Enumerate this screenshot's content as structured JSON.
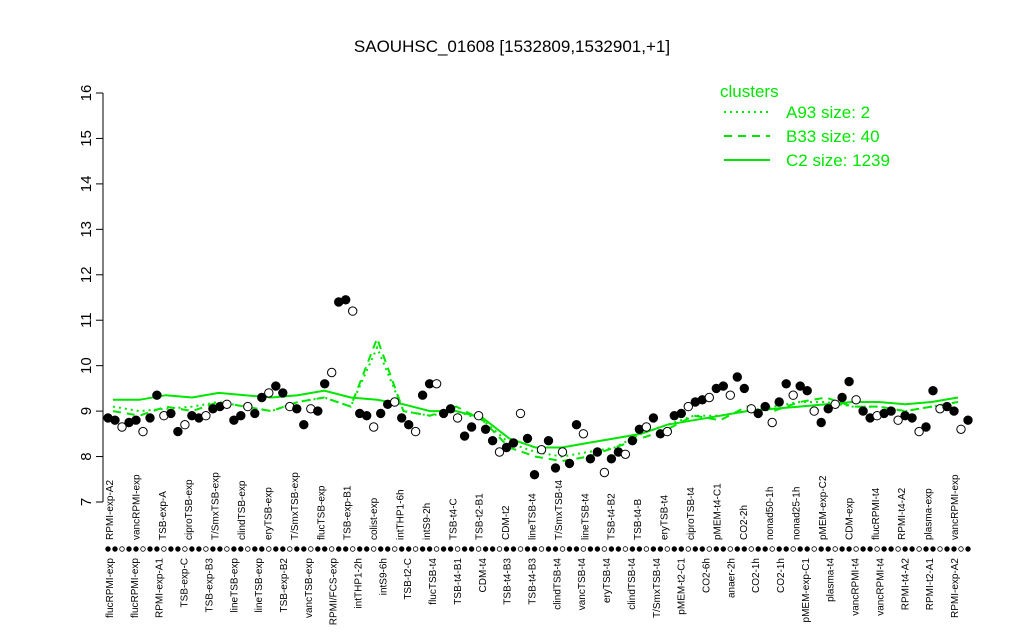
{
  "chart_data": {
    "type": "line",
    "title": "SAOUHSC_01608 [1532809,1532901,+1]",
    "xlabel": "",
    "ylabel": "",
    "ylim": [
      7,
      16
    ],
    "yticks": [
      7,
      8,
      9,
      10,
      11,
      12,
      13,
      14,
      15,
      16
    ],
    "x_labels_top": [
      "RPMI-exp-A2",
      "vancRPMI-exp",
      "TSB-exp-A",
      "ciproTSB-exp",
      "T/SmxTSB-exp",
      "clindTSB-exp",
      "eryTSB-exp",
      "T/SmxTSB-exp",
      "flucTSB-exp",
      "TSB-exp-B1",
      "colist-exp",
      "intTHP1-6h",
      "intS9-2h",
      "TSB-t4-C",
      "TSB-t2-B1",
      "CDM-t2",
      "lineTSB-t4",
      "T/SmxTSB-t4",
      "lineTSB-t4",
      "TSB-t4-B2",
      "TSB-t4-B",
      "eryTSB-t4",
      "ciproTSB-t4",
      "pMEM-t4-C1",
      "CO2-2h",
      "nonad50-1h",
      "nonad25-1h",
      "pMEM-exp-C2",
      "CDM-exp",
      "flucRPMI-t4",
      "RPMI-t4-A2",
      "plasma-exp",
      "vancRPMI-exp"
    ],
    "x_labels_bottom": [
      "flucRPMI-exp",
      "flucRPMI-exp",
      "RPMI-exp-A1",
      "TSB-exp-C",
      "TSB-exp-B3",
      "lineTSB-exp",
      "lineTSB-exp",
      "TSB-exp-B2",
      "vancTSB-exp",
      "RPMI/FCS-exp",
      "intTHP1-2h",
      "intS9-6h",
      "TSB-t2-C",
      "flucTSB-t4",
      "TSB-t4-B1",
      "CDM-t4",
      "TSB-t4-B3",
      "TSB-t4-B3",
      "clindTSB-t4",
      "vancTSB-t4",
      "eryTSB-t4",
      "clindTSB-t4",
      "T/SmxTSB-t4",
      "pMEM-t2-C1",
      "CO2-6h",
      "anaer-2h",
      "CO2-1h",
      "CO2-1h",
      "pMEM-exp-C1",
      "plasma-t4",
      "vancRPMI-t4",
      "vancRPMI-t4",
      "RPMI-t4-A2",
      "RPMI-t2-A1",
      "RPMI-exp-A2"
    ],
    "legend": {
      "title": "clusters",
      "position": "top-right",
      "entries": [
        {
          "label": "A93 size: 2",
          "style": "dotted"
        },
        {
          "label": "B33 size: 40",
          "style": "dashed"
        },
        {
          "label": "C2 size: 1239",
          "style": "solid"
        }
      ]
    },
    "colors": {
      "cluster": "#00e600",
      "points": "#000000"
    },
    "points": [
      [
        1,
        8.85
      ],
      [
        2,
        8.8
      ],
      [
        3,
        8.65
      ],
      [
        4,
        8.75
      ],
      [
        5,
        8.8
      ],
      [
        6,
        8.55
      ],
      [
        7,
        8.85
      ],
      [
        8,
        9.35
      ],
      [
        9,
        8.9
      ],
      [
        10,
        8.95
      ],
      [
        11,
        8.55
      ],
      [
        12,
        8.7
      ],
      [
        13,
        8.9
      ],
      [
        14,
        8.85
      ],
      [
        15,
        8.9
      ],
      [
        16,
        9.05
      ],
      [
        17,
        9.1
      ],
      [
        18,
        9.15
      ],
      [
        19,
        8.8
      ],
      [
        20,
        8.9
      ],
      [
        21,
        9.1
      ],
      [
        22,
        8.95
      ],
      [
        23,
        9.3
      ],
      [
        24,
        9.4
      ],
      [
        25,
        9.55
      ],
      [
        26,
        9.4
      ],
      [
        27,
        9.1
      ],
      [
        28,
        9.05
      ],
      [
        29,
        8.7
      ],
      [
        30,
        9.05
      ],
      [
        31,
        9.0
      ],
      [
        32,
        9.6
      ],
      [
        33,
        9.85
      ],
      [
        34,
        11.4
      ],
      [
        35,
        11.45
      ],
      [
        36,
        11.2
      ],
      [
        37,
        8.95
      ],
      [
        38,
        8.9
      ],
      [
        39,
        8.65
      ],
      [
        40,
        8.95
      ],
      [
        41,
        9.15
      ],
      [
        42,
        9.2
      ],
      [
        43,
        8.85
      ],
      [
        44,
        8.7
      ],
      [
        45,
        8.55
      ],
      [
        46,
        9.35
      ],
      [
        47,
        9.6
      ],
      [
        48,
        9.6
      ],
      [
        49,
        8.95
      ],
      [
        50,
        9.05
      ],
      [
        51,
        8.85
      ],
      [
        52,
        8.45
      ],
      [
        53,
        8.65
      ],
      [
        54,
        8.9
      ],
      [
        55,
        8.6
      ],
      [
        56,
        8.35
      ],
      [
        57,
        8.1
      ],
      [
        58,
        8.2
      ],
      [
        59,
        8.3
      ],
      [
        60,
        8.95
      ],
      [
        61,
        8.4
      ],
      [
        62,
        7.6
      ],
      [
        63,
        8.15
      ],
      [
        64,
        8.35
      ],
      [
        65,
        7.75
      ],
      [
        66,
        8.1
      ],
      [
        67,
        7.85
      ],
      [
        68,
        8.7
      ],
      [
        69,
        8.5
      ],
      [
        70,
        7.95
      ],
      [
        71,
        8.1
      ],
      [
        72,
        7.65
      ],
      [
        73,
        7.95
      ],
      [
        74,
        8.1
      ],
      [
        75,
        8.05
      ],
      [
        76,
        8.35
      ],
      [
        77,
        8.6
      ],
      [
        78,
        8.65
      ],
      [
        79,
        8.85
      ],
      [
        80,
        8.5
      ],
      [
        81,
        8.55
      ],
      [
        82,
        8.9
      ],
      [
        83,
        8.95
      ],
      [
        84,
        9.1
      ],
      [
        85,
        9.2
      ],
      [
        86,
        9.25
      ],
      [
        87,
        9.3
      ],
      [
        88,
        9.5
      ],
      [
        89,
        9.55
      ],
      [
        90,
        9.35
      ],
      [
        91,
        9.75
      ],
      [
        92,
        9.5
      ],
      [
        93,
        9.05
      ],
      [
        94,
        8.95
      ],
      [
        95,
        9.1
      ],
      [
        96,
        8.75
      ],
      [
        97,
        9.2
      ],
      [
        98,
        9.6
      ],
      [
        99,
        9.35
      ],
      [
        100,
        9.55
      ],
      [
        101,
        9.45
      ],
      [
        102,
        9.0
      ],
      [
        103,
        8.75
      ],
      [
        104,
        9.05
      ],
      [
        105,
        9.15
      ],
      [
        106,
        9.3
      ],
      [
        107,
        9.65
      ],
      [
        108,
        9.25
      ],
      [
        109,
        9.0
      ],
      [
        110,
        8.85
      ],
      [
        111,
        8.9
      ],
      [
        112,
        8.95
      ],
      [
        113,
        9.0
      ],
      [
        114,
        8.8
      ],
      [
        115,
        8.9
      ],
      [
        116,
        8.85
      ],
      [
        117,
        8.55
      ],
      [
        118,
        8.65
      ],
      [
        119,
        9.45
      ],
      [
        120,
        9.05
      ],
      [
        121,
        9.1
      ],
      [
        122,
        9.0
      ],
      [
        123,
        8.6
      ],
      [
        124,
        8.8
      ]
    ],
    "series": [
      {
        "name": "A93 size: 2",
        "style": "dotted",
        "values": [
          9.1,
          9.0,
          9.05,
          9.1,
          9.2,
          9.1,
          9.0,
          9.2,
          9.3,
          9.1,
          10.4,
          9.0,
          8.9,
          9.0,
          8.8,
          8.3,
          8.1,
          8.0,
          8.1,
          8.2,
          8.5,
          8.7,
          8.9,
          8.9,
          9.0,
          9.1,
          9.2,
          9.2,
          9.1,
          9.1,
          9.0,
          9.1,
          9.2
        ]
      },
      {
        "name": "B33 size: 40",
        "style": "dashed",
        "values": [
          9.0,
          8.9,
          9.1,
          9.0,
          9.2,
          9.1,
          9.0,
          9.2,
          9.3,
          9.1,
          10.6,
          9.0,
          8.9,
          9.1,
          8.8,
          8.2,
          8.0,
          7.9,
          8.0,
          8.2,
          8.4,
          8.6,
          8.9,
          8.8,
          9.1,
          9.0,
          9.2,
          9.3,
          9.1,
          9.1,
          9.0,
          9.1,
          9.2
        ]
      },
      {
        "name": "C2 size: 1239",
        "style": "solid",
        "values": [
          9.25,
          9.25,
          9.35,
          9.3,
          9.4,
          9.35,
          9.3,
          9.35,
          9.45,
          9.3,
          9.25,
          9.15,
          9.0,
          9.0,
          8.85,
          8.4,
          8.2,
          8.2,
          8.3,
          8.4,
          8.5,
          8.7,
          8.8,
          8.9,
          9.0,
          9.05,
          9.1,
          9.15,
          9.2,
          9.2,
          9.15,
          9.2,
          9.3
        ]
      }
    ]
  }
}
